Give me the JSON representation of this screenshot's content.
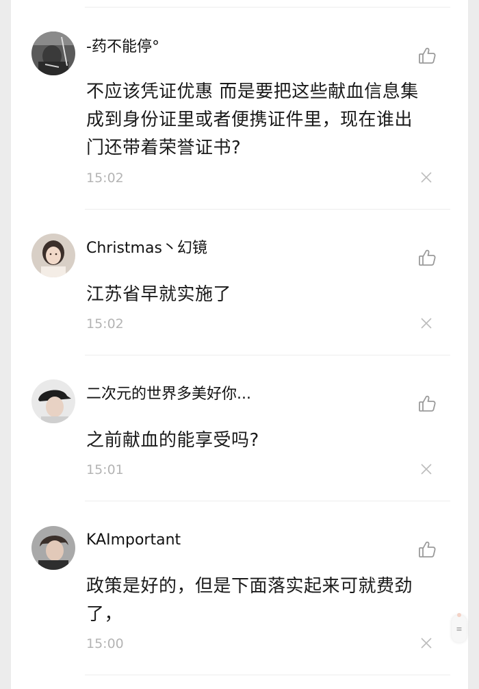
{
  "comments": [
    {
      "username": "-药不能停°",
      "body": "不应该凭证优惠 而是要把这些献血信息集成到身份证里或者便携证件里，现在谁出门还带着荣誉证书?",
      "time": "15:02",
      "avatar": "avatar-photo-dark"
    },
    {
      "username": "Christmas丶幻镜",
      "body": "江苏省早就实施了",
      "time": "15:02",
      "avatar": "avatar-photo-girl"
    },
    {
      "username": "二次元的世界多美好你...",
      "body": "之前献血的能享受吗?",
      "time": "15:01",
      "avatar": "avatar-photo-cap"
    },
    {
      "username": "KAImportant",
      "body": "政策是好的，但是下面落实起来可就费劲了，",
      "time": "15:00",
      "avatar": "avatar-photo-man"
    }
  ],
  "icons": {
    "like": "thumbs-up-icon",
    "close": "close-icon",
    "float": "menu-handle-icon"
  },
  "float_handle": {
    "glyph": "≡"
  },
  "colors": {
    "timestamp": "#b4b4b4",
    "divider": "#ededed",
    "icon": "#9a9a9a"
  }
}
